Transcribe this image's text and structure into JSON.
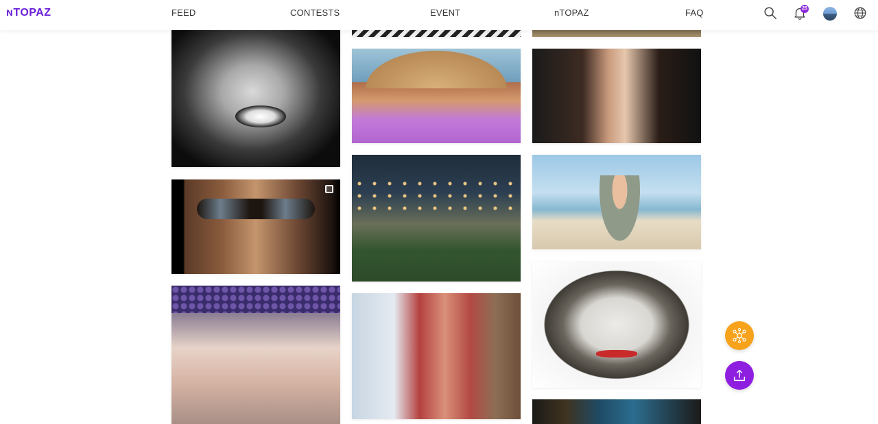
{
  "brand": {
    "logo": "ɴTOPAZ",
    "accent": "#6a20d8"
  },
  "nav": {
    "feed": "FEED",
    "contests": "CONTESTS",
    "event": "EVENT",
    "ntopaz": "nTOPAZ",
    "faq": "FAQ"
  },
  "header_icons": {
    "search": "search-icon",
    "notifications": "bell-icon",
    "notification_count": "25",
    "avatar": "user-avatar",
    "language": "globe-icon"
  },
  "feed": {
    "photos": [
      {
        "subject": "woman black and white portrait"
      },
      {
        "subject": "man with sunglasses"
      },
      {
        "subject": "girl with flower crown"
      },
      {
        "subject": "woman in straw hat"
      },
      {
        "subject": "woman under string lights"
      },
      {
        "subject": "woman with red hair"
      },
      {
        "subject": "two children"
      },
      {
        "subject": "woman on beach"
      },
      {
        "subject": "man with joker makeup"
      },
      {
        "subject": "blue door"
      }
    ]
  },
  "fabs": {
    "network": {
      "icon": "network-icon",
      "color": "#f7a21b"
    },
    "upload": {
      "icon": "upload-icon",
      "color": "#8f1fe0"
    }
  }
}
